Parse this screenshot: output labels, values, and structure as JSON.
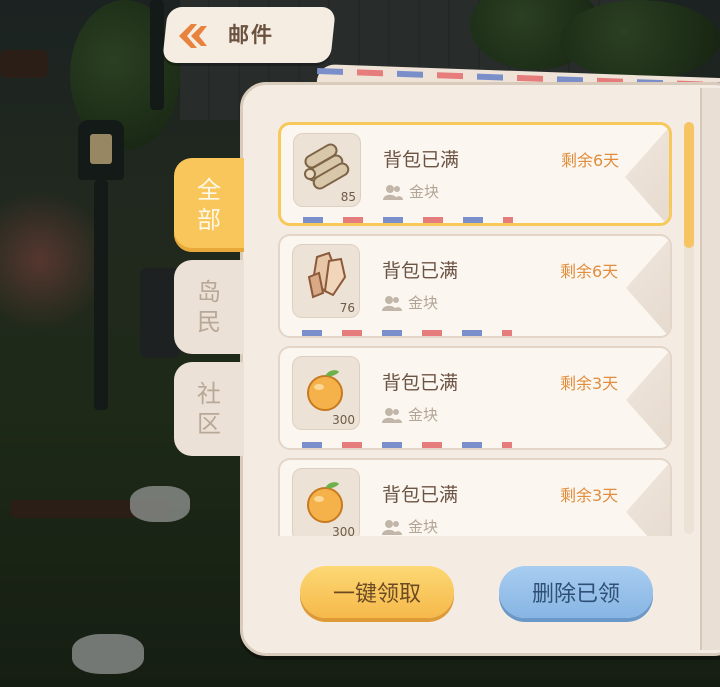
{
  "header": {
    "title": "邮件"
  },
  "tabs": [
    {
      "label_line1": "全",
      "label_line2": "部",
      "active": true
    },
    {
      "label_line1": "岛",
      "label_line2": "民",
      "active": false
    },
    {
      "label_line1": "社",
      "label_line2": "区",
      "active": false
    }
  ],
  "mails": [
    {
      "title": "背包已满",
      "remaining": "剩余6天",
      "reward": "金块",
      "count": "85",
      "item_icon": "wood-logs-icon",
      "selected": true
    },
    {
      "title": "背包已满",
      "remaining": "剩余6天",
      "reward": "金块",
      "count": "76",
      "item_icon": "crystal-ore-icon",
      "selected": false
    },
    {
      "title": "背包已满",
      "remaining": "剩余3天",
      "reward": "金块",
      "count": "300",
      "item_icon": "orange-fruit-icon",
      "selected": false
    },
    {
      "title": "背包已满",
      "remaining": "剩余3天",
      "reward": "金块",
      "count": "300",
      "item_icon": "orange-fruit-icon",
      "selected": false
    }
  ],
  "buttons": {
    "claim_all": "一键领取",
    "delete_claimed": "删除已领"
  },
  "colors": {
    "accent": "#f8c65a",
    "days_text": "#e08e3c",
    "claim_button": "#f6b94a",
    "delete_button": "#87b5e4"
  }
}
